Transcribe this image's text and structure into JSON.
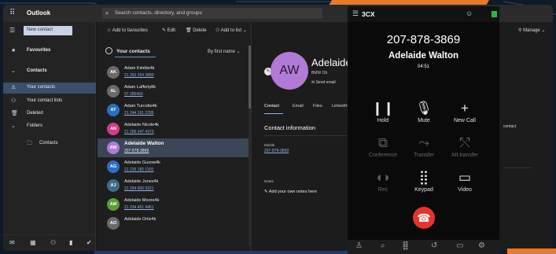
{
  "outlook": {
    "app_name": "Outlook",
    "search_placeholder": "Search contacts, directory, and groups",
    "new_contact": "New contact",
    "nav": {
      "favourites": "Favourites",
      "contacts": "Contacts",
      "your_contacts": "Your contacts",
      "your_contact_lists": "Your contact lists",
      "deleted": "Deleted",
      "folders": "Folders",
      "folder_contacts": "Contacts"
    },
    "commands": {
      "add_favourites": "Add to favourites",
      "edit": "Edit",
      "delete": "Delete",
      "add_to_list": "Add to list",
      "manage": "Manage"
    },
    "list": {
      "title": "Your contacts",
      "sort": "By first name",
      "rows": [
        {
          "initials": "AK",
          "name": "Adam Kimble4k",
          "phone": "21 263 254 3890",
          "color": "#6a6a6a"
        },
        {
          "initials": "AL",
          "name": "Adam Lafferty8k",
          "phone": "97 285493",
          "color": "#6a6a6a"
        },
        {
          "initials": "AT",
          "name": "Adam Turcotte4k",
          "phone": "21 244 151 2295",
          "color": "#2a6fc4"
        },
        {
          "initials": "AN",
          "name": "Adelaide Nicole4k",
          "phone": "21 256 347 4373",
          "color": "#d43b8c"
        },
        {
          "initials": "AW",
          "name": "Adelaide Walton",
          "phone": "207-878-3869",
          "color": "#b17ad6"
        },
        {
          "initials": "AG",
          "name": "Adelaide Gusow4k",
          "phone": "21 226 182 1331",
          "color": "#2a6fc4"
        },
        {
          "initials": "AJ",
          "name": "Adelaide Jones4k",
          "phone": "21 254 905 9321",
          "color": "#3a6f8a"
        },
        {
          "initials": "AM",
          "name": "Adelaide Moore4k",
          "phone": "21 234 451 4461",
          "color": "#5a9e3a"
        },
        {
          "initials": "AO",
          "name": "Adelaide Ortiz4k",
          "phone": "",
          "color": "#6a6a6a"
        }
      ]
    },
    "detail": {
      "initials": "AW",
      "name": "Adelaide",
      "sub1": "BMW Ob",
      "sub2": "Send email",
      "tabs": [
        "Contact",
        "Email",
        "Files",
        "LinkedIn"
      ],
      "section": "Contact information",
      "mobile_label": "Mobile",
      "mobile_value": "207-878-3869",
      "notes_label": "Notes",
      "notes_add": "Add your own notes here",
      "right_label": "contact"
    }
  },
  "phone": {
    "brand": "3CX",
    "number": "207-878-3869",
    "caller": "Adelaide Walton",
    "timer": "04:51",
    "buttons": [
      {
        "label": "Hold",
        "icon": "pause-icon",
        "glyph": "❙❙",
        "dim": false
      },
      {
        "label": "Mute",
        "icon": "microphone-icon",
        "glyph": "🎙",
        "dim": false
      },
      {
        "label": "New Call",
        "icon": "plus-icon",
        "glyph": "+",
        "dim": false
      },
      {
        "label": "Conference",
        "icon": "conference-icon",
        "glyph": "⧉",
        "dim": true
      },
      {
        "label": "Transfer",
        "icon": "transfer-icon",
        "glyph": "⤳",
        "dim": true
      },
      {
        "label": "Att.transfer",
        "icon": "attended-transfer-icon",
        "glyph": "⤲",
        "dim": true
      },
      {
        "label": "Rec",
        "icon": "record-icon",
        "glyph": "◖◗",
        "dim": true
      },
      {
        "label": "Keypad",
        "icon": "keypad-icon",
        "glyph": "⣿",
        "dim": false
      },
      {
        "label": "Video",
        "icon": "video-icon",
        "glyph": "▭",
        "dim": false
      }
    ],
    "hangup_color": "#e5342c",
    "accent": "#e8792a"
  }
}
